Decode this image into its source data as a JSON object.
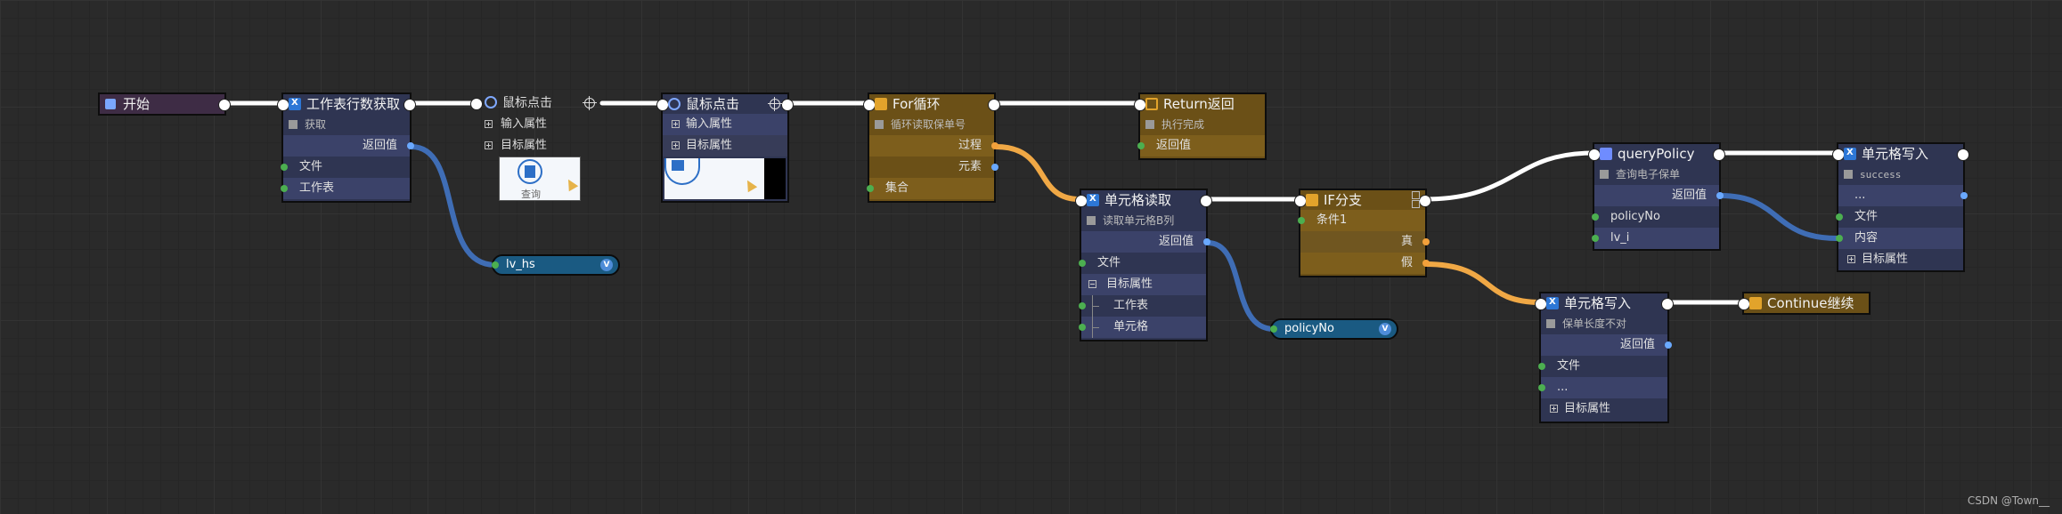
{
  "nodes": {
    "start": {
      "title": "开始"
    },
    "sheet_rows": {
      "title": "工作表行数获取",
      "note": "获取",
      "rows": [
        "返回值",
        "文件",
        "工作表"
      ]
    },
    "click1": {
      "title": "鼠标点击",
      "rows": [
        "输入属性",
        "目标属性"
      ],
      "thumb_label": "查询"
    },
    "click2": {
      "title": "鼠标点击",
      "rows": [
        "输入属性",
        "目标属性"
      ]
    },
    "for_loop": {
      "title": "For循环",
      "note": "循环读取保单号",
      "rows": [
        "过程",
        "元素",
        "集合"
      ]
    },
    "return": {
      "title": "Return返回",
      "note": "执行完成",
      "rows": [
        "返回值"
      ]
    },
    "cell_read": {
      "title": "单元格读取",
      "note": "读取单元格B列",
      "rows": [
        "返回值",
        "文件",
        "目标属性",
        "工作表",
        "单元格"
      ]
    },
    "if_branch": {
      "title": "IF分支",
      "rows": [
        "条件1",
        "真",
        "假"
      ]
    },
    "query_policy": {
      "title": "queryPolicy",
      "note": "查询电子保单",
      "rows": [
        "返回值",
        "policyNo",
        "lv_i"
      ]
    },
    "cell_write1": {
      "title": "单元格写入",
      "note": "success",
      "rows": [
        "...",
        "文件",
        "内容",
        "目标属性"
      ]
    },
    "cell_write2": {
      "title": "单元格写入",
      "note": "保单长度不对",
      "rows": [
        "返回值",
        "文件",
        "...",
        "目标属性"
      ]
    },
    "continue": {
      "title": "Continue继续"
    }
  },
  "variables": [
    {
      "name": "lv_hs",
      "badge": "V"
    },
    {
      "name": "policyNo",
      "badge": "V"
    }
  ],
  "watermark": "CSDN @Town__",
  "colors": {
    "background": "#2a2a2a",
    "node_blue": "#2f3552",
    "node_gold": "#6b5017",
    "node_plum": "#3e2c45",
    "wire_exec": "#ffffff",
    "wire_data_blue": "#3f6db5",
    "wire_data_orange": "#f0a845",
    "variable_pill": "#1a5a82"
  }
}
